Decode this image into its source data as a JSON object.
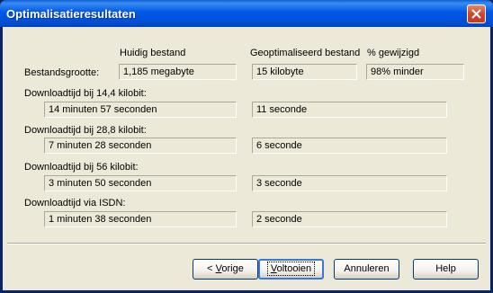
{
  "window": {
    "title": "Optimalisatieresultaten"
  },
  "headers": {
    "current": "Huidig bestand",
    "optimized": "Geoptimaliseerd bestand",
    "changed": "% gewijzigd"
  },
  "file_size": {
    "label": "Bestandsgrootte:",
    "current": "1,185 megabyte",
    "optimized": "15 kilobyte",
    "changed": "98% minder"
  },
  "downloads": [
    {
      "label": "Downloadtijd bij 14,4 kilobit:",
      "current": "14 minuten 57 seconden",
      "optimized": "11 seconde"
    },
    {
      "label": "Downloadtijd bij 28,8 kilobit:",
      "current": "7 minuten 28 seconden",
      "optimized": "6 seconde"
    },
    {
      "label": "Downloadtijd bij 56 kilobit:",
      "current": "3 minuten 50 seconden",
      "optimized": "3 seconde"
    },
    {
      "label": "Downloadtijd via ISDN:",
      "current": "1 minuten 38 seconden",
      "optimized": "2 seconde"
    }
  ],
  "buttons": {
    "back": {
      "prefix": "< ",
      "accel": "V",
      "rest": "orige"
    },
    "finish": {
      "accel": "V",
      "rest": "oltooien"
    },
    "cancel": "Annuleren",
    "help": "Help"
  }
}
